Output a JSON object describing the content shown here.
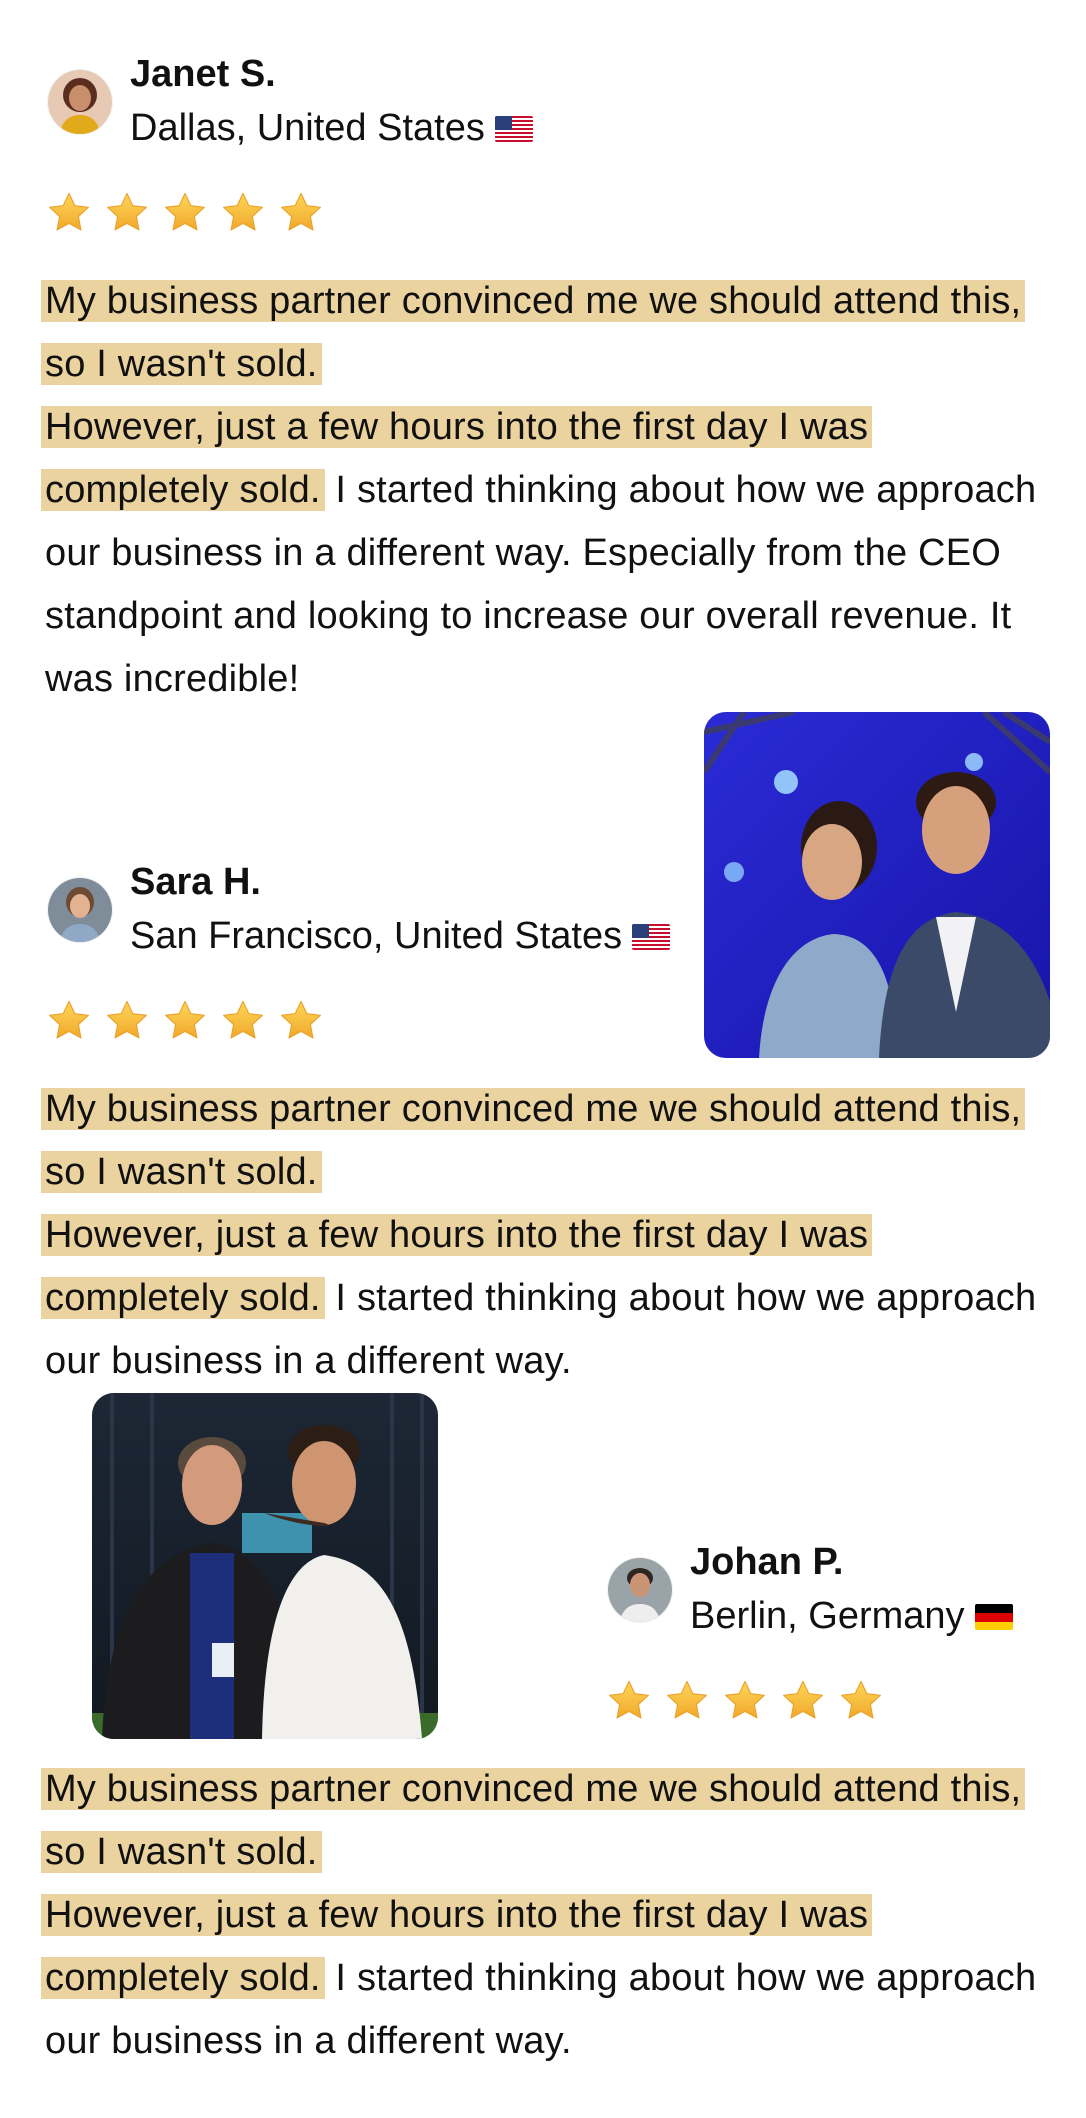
{
  "colors": {
    "highlight": "#ead39f",
    "star": "#f6b93b",
    "text": "#111111"
  },
  "reviews": [
    {
      "name": "Janet S.",
      "location": "Dallas, United States",
      "flag": "us-flag-icon",
      "rating": 5,
      "highlighted": [
        "My business partner convinced me we should attend this, so I wasn't sold.",
        "However, just a few hours into the first day I was completely sold."
      ],
      "body": " I started thinking about how we approach our business in a different way. Especially from the CEO standpoint and looking to increase our overall revenue. It was incredible!"
    },
    {
      "name": "Sara H.",
      "location": "San Francisco, United States",
      "flag": "us-flag-icon",
      "rating": 5,
      "highlighted": [
        "My business partner convinced me we should attend this, so I wasn't sold.",
        "However, just a few hours into the first day I was completely sold."
      ],
      "body": " I started thinking about how we approach our business in a different way."
    },
    {
      "name": "Johan P.",
      "location": "Berlin, Germany",
      "flag": "de-flag-icon",
      "rating": 5,
      "highlighted": [
        "My business partner convinced me we should attend this, so I wasn't sold.",
        "However, just a few hours into the first day I was completely sold."
      ],
      "body": " I started thinking about how we approach our business in a different way."
    }
  ]
}
